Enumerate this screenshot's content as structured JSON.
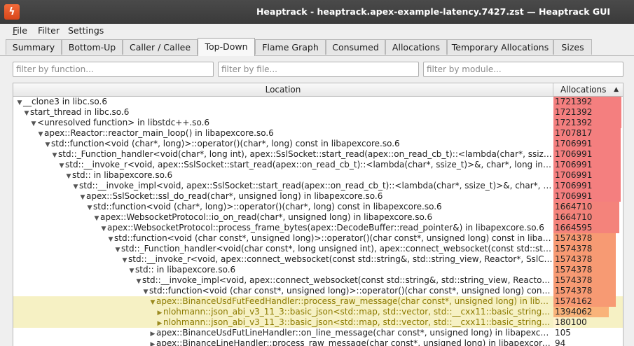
{
  "window": {
    "title": "Heaptrack - heaptrack.apex-example-latency.7427.zst — Heaptrack GUI"
  },
  "menu": [
    {
      "label": "File",
      "mnemonic": "F",
      "rest": "ile"
    },
    {
      "label": "Filter",
      "mnemonic": "",
      "rest": "Filter"
    },
    {
      "label": "Settings",
      "mnemonic": "",
      "rest": "Settings"
    }
  ],
  "tabs": [
    "Summary",
    "Bottom-Up",
    "Caller / Callee",
    "Top-Down",
    "Flame Graph",
    "Consumed",
    "Allocations",
    "Temporary Allocations",
    "Sizes"
  ],
  "active_tab": "Top-Down",
  "filters": {
    "function_placeholder": "filter by function...",
    "file_placeholder": "filter by file...",
    "module_placeholder": "filter by module..."
  },
  "columns": {
    "location": "Location",
    "allocations": "Allocations"
  },
  "max_allocations": 1721392,
  "rows": [
    {
      "depth": 0,
      "expanded": true,
      "location": "__clone3 in libc.so.6",
      "allocations": "1721392",
      "value": 1721392,
      "color": "#f47f7f",
      "highlight": false
    },
    {
      "depth": 1,
      "expanded": true,
      "location": "start_thread in libc.so.6",
      "allocations": "1721392",
      "value": 1721392,
      "color": "#f47f7f",
      "highlight": false
    },
    {
      "depth": 2,
      "expanded": true,
      "location": "<unresolved function> in libstdc++.so.6",
      "allocations": "1721392",
      "value": 1721392,
      "color": "#f47f7f",
      "highlight": false
    },
    {
      "depth": 3,
      "expanded": true,
      "location": "apex::Reactor::reactor_main_loop() in libapexcore.so.6",
      "allocations": "1707817",
      "value": 1707817,
      "color": "#f47f7f",
      "highlight": false
    },
    {
      "depth": 4,
      "expanded": true,
      "location": "std::function<void (char*, long)>::operator()(char*, long) const in libapexcore.so.6",
      "allocations": "1706991",
      "value": 1706991,
      "color": "#f47f7f",
      "highlight": false
    },
    {
      "depth": 5,
      "expanded": true,
      "location": "std::_Function_handler<void(char*, long int), apex::SslSocket::start_read(apex::on_read_cb_t)::<lambda(char*, ssize_t)...",
      "allocations": "1706991",
      "value": 1706991,
      "color": "#f47f7f",
      "highlight": false
    },
    {
      "depth": 6,
      "expanded": true,
      "location": "std::__invoke_r<void, apex::SslSocket::start_read(apex::on_read_cb_t)::<lambda(char*, ssize_t)>&, char*, long int> in...",
      "allocations": "1706991",
      "value": 1706991,
      "color": "#f47f7f",
      "highlight": false
    },
    {
      "depth": 7,
      "expanded": true,
      "location": "std:: in libapexcore.so.6",
      "allocations": "1706991",
      "value": 1706991,
      "color": "#f47f7f",
      "highlight": false
    },
    {
      "depth": 8,
      "expanded": true,
      "location": "std::__invoke_impl<void, apex::SslSocket::start_read(apex::on_read_cb_t)::<lambda(char*, ssize_t)>&, char*, long...",
      "allocations": "1706991",
      "value": 1706991,
      "color": "#f47f7f",
      "highlight": false
    },
    {
      "depth": 9,
      "expanded": true,
      "location": "apex::SslSocket::ssl_do_read(char*, unsigned long) in libapexcore.so.6",
      "allocations": "1706991",
      "value": 1706991,
      "color": "#f47f7f",
      "highlight": false
    },
    {
      "depth": 10,
      "expanded": true,
      "location": "std::function<void (char*, long)>::operator()(char*, long) const in libapexcore.so.6",
      "allocations": "1664710",
      "value": 1664710,
      "color": "#f4837b",
      "highlight": false
    },
    {
      "depth": 11,
      "expanded": true,
      "location": "apex::WebsocketProtocol::io_on_read(char*, unsigned long) in libapexcore.so.6",
      "allocations": "1664710",
      "value": 1664710,
      "color": "#f4837b",
      "highlight": false
    },
    {
      "depth": 12,
      "expanded": true,
      "location": "apex::WebsocketProtocol::process_frame_bytes(apex::DecodeBuffer::read_pointer&) in libapexcore.so.6",
      "allocations": "1664595",
      "value": 1664595,
      "color": "#f4837b",
      "highlight": false
    },
    {
      "depth": 13,
      "expanded": true,
      "location": "std::function<void (char const*, unsigned long)>::operator()(char const*, unsigned long) const in libapexco...",
      "allocations": "1574378",
      "value": 1574378,
      "color": "#f79a73",
      "highlight": false
    },
    {
      "depth": 14,
      "expanded": true,
      "location": "std::_Function_handler<void(char const*, long unsigned int), apex::connect_websocket(const std::string...",
      "allocations": "1574378",
      "value": 1574378,
      "color": "#f79a73",
      "highlight": false
    },
    {
      "depth": 15,
      "expanded": true,
      "location": "std::__invoke_r<void, apex::connect_websocket(const std::string&, std::string_view, Reactor*, SslConnect...",
      "allocations": "1574378",
      "value": 1574378,
      "color": "#f79a73",
      "highlight": false
    },
    {
      "depth": 16,
      "expanded": true,
      "location": "std:: in libapexcore.so.6",
      "allocations": "1574378",
      "value": 1574378,
      "color": "#f79a73",
      "highlight": false
    },
    {
      "depth": 17,
      "expanded": true,
      "location": "std::__invoke_impl<void, apex::connect_websocket(const std::string&, std::string_view, Reactor*, S...",
      "allocations": "1574378",
      "value": 1574378,
      "color": "#f79a73",
      "highlight": false
    },
    {
      "depth": 18,
      "expanded": true,
      "location": "std::function<void (char const*, unsigned long)>::operator()(char const*, unsigned long) const in li...",
      "allocations": "1574378",
      "value": 1574378,
      "color": "#f79a73",
      "highlight": false
    },
    {
      "depth": 19,
      "expanded": true,
      "location": "apex::BinanceUsdFutFeedHandler::process_raw_message(char const*, unsigned long) in libap...",
      "allocations": "1574162",
      "value": 1574162,
      "color": "#f79a73",
      "highlight": true
    },
    {
      "depth": 20,
      "expanded": false,
      "location": "nlohmann::json_abi_v3_11_3::basic_json<std::map, std::vector, std::__cxx11::basic_string<ch...",
      "allocations": "1394062",
      "value": 1394062,
      "color": "#f9b37a",
      "highlight": true
    },
    {
      "depth": 20,
      "expanded": false,
      "location": "nlohmann::json_abi_v3_11_3::basic_json<std::map, std::vector, std::__cxx11::basic_string<ch...",
      "allocations": "180100",
      "value": 180100,
      "color": "#fff3cf",
      "highlight": true
    },
    {
      "depth": 19,
      "expanded": false,
      "location": "apex::BinanceUsdFutLineHandler::on_line_message(char const*, unsigned long) in libapexcore...",
      "allocations": "105",
      "value": 105,
      "color": "#ffffff",
      "highlight": false
    },
    {
      "depth": 19,
      "expanded": false,
      "location": "apex::BinanceLineHandler::process_raw_message(char const*, unsigned long) in libapexcore.s...",
      "allocations": "94",
      "value": 94,
      "color": "#ffffff",
      "highlight": false
    }
  ]
}
